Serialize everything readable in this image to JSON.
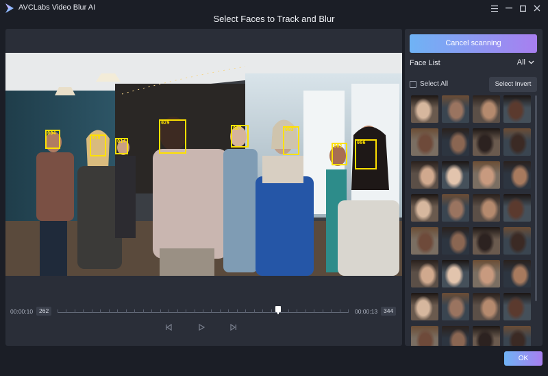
{
  "window": {
    "title": "AVCLabs Video Blur AI",
    "dialog_title": "Select Faces to Track and Blur",
    "controls": [
      "menu-icon",
      "minimize-icon",
      "maximize-icon",
      "close-icon"
    ]
  },
  "video": {
    "faces": [
      {
        "id": "004"
      },
      {
        "id": "018"
      },
      {
        "id": "014"
      },
      {
        "id": "029"
      },
      {
        "id": "007"
      },
      {
        "id": "003"
      },
      {
        "id": "002"
      },
      {
        "id": "006"
      }
    ],
    "timeline": {
      "start_time": "00:00:10",
      "start_frame": "262",
      "end_time": "00:00:13",
      "end_frame": "344",
      "playhead_fraction": 0.76
    },
    "controls": [
      "skip-back-icon",
      "play-icon",
      "skip-forward-icon"
    ]
  },
  "face_panel": {
    "cancel_label": "Cancel scanning",
    "list_label": "Face List",
    "filter_value": "All",
    "select_all_label": "Select All",
    "select_invert_label": "Select Invert",
    "thumb_count": 32
  },
  "footer": {
    "ok_label": "OK"
  },
  "colors": {
    "accent_gradient_start": "#6fb3f5",
    "accent_gradient_end": "#a87ff0",
    "face_box": "#ffe100",
    "background": "#1b1e26",
    "panel": "#2a2e38"
  }
}
